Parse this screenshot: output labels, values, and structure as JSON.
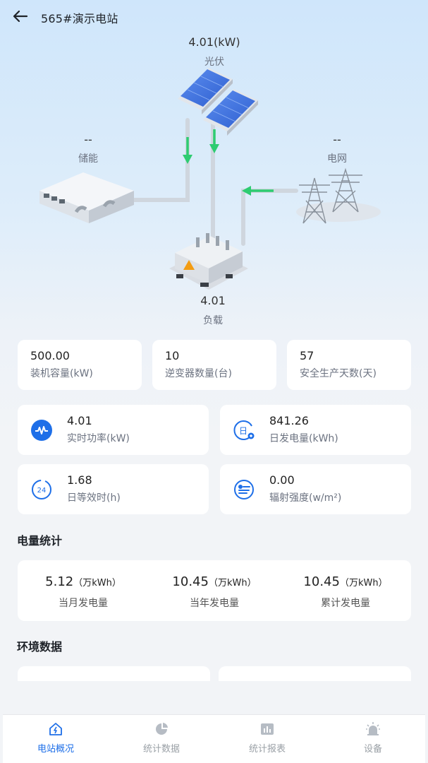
{
  "header": {
    "title": "565#演示电站"
  },
  "flow": {
    "pv": {
      "value": "4.01(kW)",
      "label": "光伏"
    },
    "storage": {
      "value": "--",
      "label": "储能"
    },
    "grid": {
      "value": "--",
      "label": "电网"
    },
    "load": {
      "value": "4.01",
      "label": "负载"
    }
  },
  "stats": [
    {
      "value": "500.00",
      "label": "装机容量(kW)"
    },
    {
      "value": "10",
      "label": "逆变器数量(台)"
    },
    {
      "value": "57",
      "label": "安全生产天数(天)"
    }
  ],
  "metrics": [
    {
      "value": "4.01",
      "label": "实时功率(kW)",
      "icon": "realtime-power-icon"
    },
    {
      "value": "841.26",
      "label": "日发电量(kWh)",
      "icon": "daily-generation-icon"
    },
    {
      "value": "1.68",
      "label": "日等效时(h)",
      "icon": "equivalent-hours-icon"
    },
    {
      "value": "0.00",
      "label": "辐射强度(w/m²)",
      "icon": "irradiance-icon"
    }
  ],
  "energy": {
    "title": "电量统计",
    "items": [
      {
        "value": "5.12",
        "unit": "（万kWh）",
        "label": "当月发电量"
      },
      {
        "value": "10.45",
        "unit": "（万kWh）",
        "label": "当年发电量"
      },
      {
        "value": "10.45",
        "unit": "（万kWh）",
        "label": "累计发电量"
      }
    ]
  },
  "environment": {
    "title": "环境数据"
  },
  "tabs": [
    {
      "label": "电站概况",
      "icon": "station-icon",
      "active": true
    },
    {
      "label": "统计数据",
      "icon": "pie-chart-icon",
      "active": false
    },
    {
      "label": "统计报表",
      "icon": "bar-report-icon",
      "active": false
    },
    {
      "label": "设备",
      "icon": "device-alarm-icon",
      "active": false
    }
  ],
  "colors": {
    "accent": "#1e6fe8",
    "flow_arrow": "#2ecc71",
    "card": "#ffffff"
  }
}
